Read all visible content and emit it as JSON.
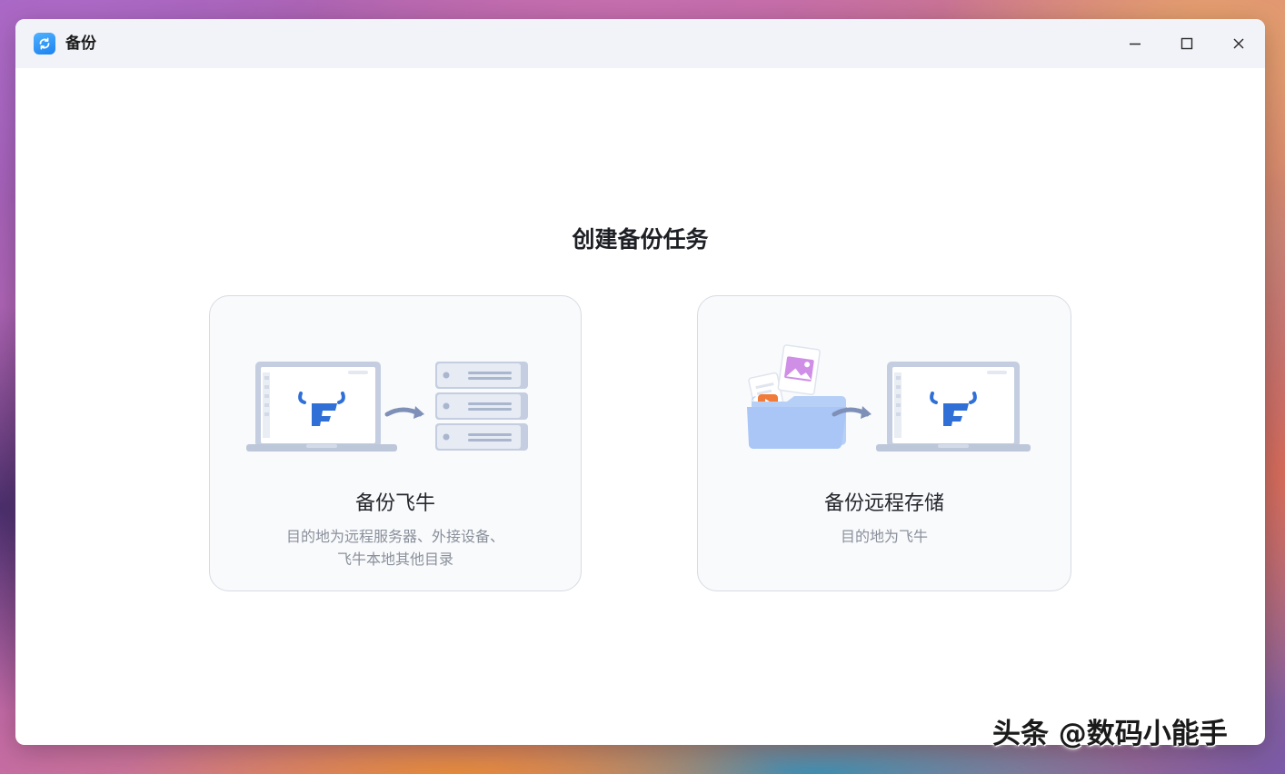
{
  "window": {
    "title": "备份",
    "app_icon": "backup-sync-icon",
    "controls": [
      "minimize-icon",
      "maximize-icon",
      "close-icon"
    ]
  },
  "main": {
    "heading": "创建备份任务",
    "cards": [
      {
        "title": "备份飞牛",
        "description_lines": [
          "目的地为远程服务器、外接设备、",
          "飞牛本地其他目录"
        ],
        "illustration": "laptop-to-server-illustration"
      },
      {
        "title": "备份远程存储",
        "description_lines": [
          "目的地为飞牛"
        ],
        "illustration": "folder-to-laptop-illustration"
      }
    ]
  },
  "watermark": {
    "text": "头条 @数码小能手"
  },
  "colors": {
    "accent": "#2f6fd6",
    "title_bar": "#f2f3f8",
    "card_bg": "#f9fafc",
    "card_border": "#d7dbe2",
    "desc_text": "#8a909b"
  }
}
